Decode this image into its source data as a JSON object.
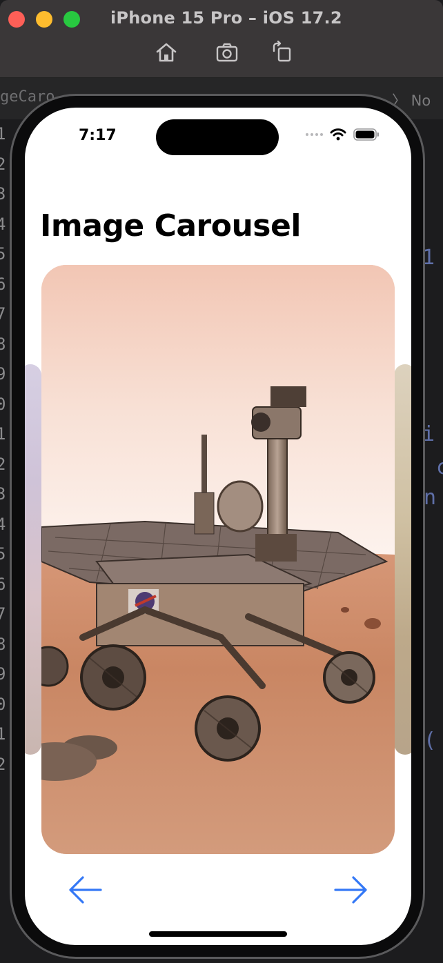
{
  "window": {
    "title": "iPhone 15 Pro – iOS 17.2",
    "toolbar": {
      "home_icon": "home-icon",
      "screenshot_icon": "camera-icon",
      "rotate_icon": "rotate-icon"
    }
  },
  "background_editor": {
    "tab_fragment": "geCaro",
    "right_label_fragment": "〉 No Se",
    "line_number_fragments": [
      "1",
      "2",
      "3",
      "4",
      "5",
      "6",
      "7",
      "8",
      "9",
      "0",
      "1",
      "2",
      "3",
      "4",
      "5",
      "6",
      "7",
      "8",
      "9",
      "0",
      "1",
      "2"
    ]
  },
  "status_bar": {
    "time": "7:17"
  },
  "screen": {
    "title": "Image Carousel",
    "carousel": {
      "current_image": "mars-rover-illustration",
      "prev_button_icon": "arrow-left-icon",
      "next_button_icon": "arrow-right-icon"
    }
  },
  "colors": {
    "accent": "#3478f6",
    "titlebar": "#3a3738",
    "traffic_red": "#fe5f57",
    "traffic_yellow": "#febc2e",
    "traffic_green": "#28c840"
  }
}
